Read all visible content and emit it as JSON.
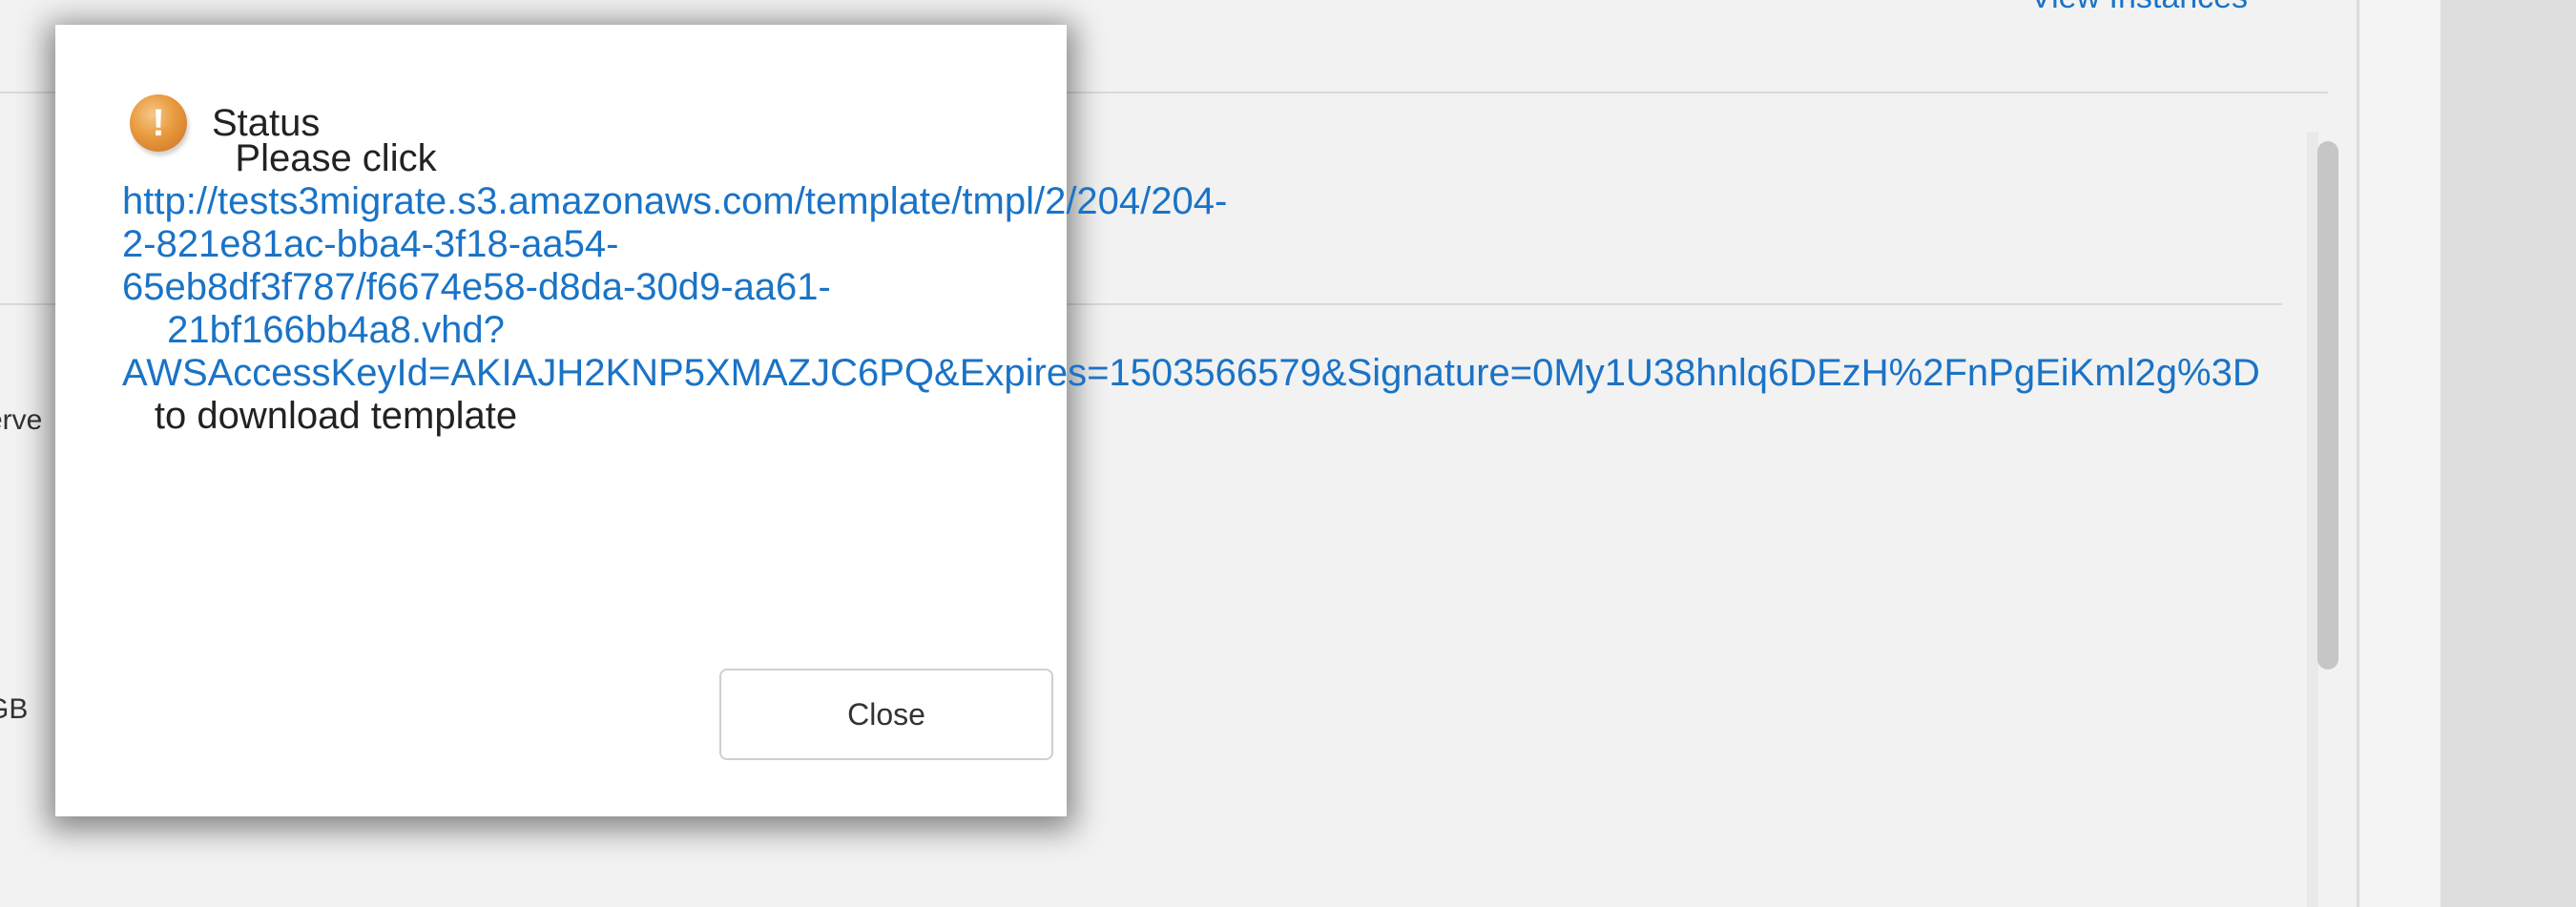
{
  "background": {
    "view_instances_link": "View Instances",
    "cut_text_1": "erve",
    "cut_text_2": "GB"
  },
  "modal": {
    "title": "Status",
    "icon": "warning-icon",
    "message_prefix": "Please click",
    "url_lines": [
      "http://tests3migrate.s3.amazonaws.com/template/tmpl/2/204/204-",
      "2-821e81ac-bba4-3f18-aa54-",
      "65eb8df3f787/f6674e58-d8da-30d9-aa61-",
      "21bf166bb4a8.vhd?",
      "AWSAccessKeyId=AKIAJH2KNP5XMAZJC6PQ&Expires=1503566579&Signature=0My1U38hnlq6DEzH%2FnPgEiKml2g%3D"
    ],
    "message_suffix": "to download template",
    "close_label": "Close"
  },
  "colors": {
    "link": "#1a73c6",
    "icon_orange": "#e89a3c"
  }
}
